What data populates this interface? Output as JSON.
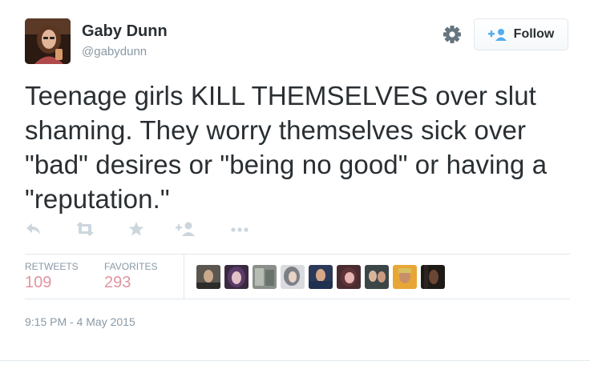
{
  "author": {
    "name": "Gaby Dunn",
    "handle": "@gabydunn"
  },
  "header": {
    "settings_icon": "gear-icon",
    "follow_icon": "follow-person-plus-icon",
    "follow_label": "Follow"
  },
  "tweet": {
    "text": "Teenage girls KILL THEMSELVES over slut shaming. They worry themselves sick over \"bad\" desires or \"being no good\" or having a \"reputation.\""
  },
  "actions": [
    "reply-icon",
    "retweet-icon",
    "favorite-star-icon",
    "follow-person-plus-icon",
    "more-dots-icon"
  ],
  "stats": {
    "retweets_label": "RETWEETS",
    "retweets_count": "109",
    "favorites_label": "FAVORITES",
    "favorites_count": "293",
    "favoriter_avatar_count": 9
  },
  "timestamp": "9:15 PM - 4 May 2015",
  "colors": {
    "text": "#292f33",
    "muted": "#8899a6",
    "stat_value": "#e0969f",
    "action_icon": "#ccd6dd",
    "follow_icon": "#55acee",
    "border": "#e1e8ed"
  }
}
